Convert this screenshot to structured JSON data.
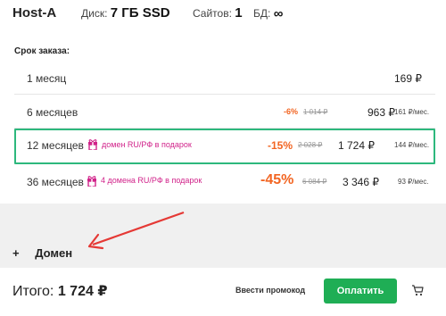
{
  "header": {
    "plan_name": "Host-A",
    "disk_label": "Диск:",
    "disk_value": "7 ГБ SSD",
    "sites_label": "Сайтов:",
    "sites_value": "1",
    "db_label": "БД:",
    "db_value": "∞"
  },
  "term_label": "Срок заказа:",
  "rows": [
    {
      "label": "1 месяц",
      "price": "169 ₽"
    },
    {
      "label": "6 месяцев",
      "discount": "-6%",
      "old_price": "1 014 ₽",
      "price": "963 ₽",
      "per_month": "161 ₽/мес."
    },
    {
      "label": "12 месяцев",
      "gift": "домен RU/РФ в подарок",
      "discount": "-15%",
      "old_price": "2 028 ₽",
      "price": "1 724 ₽",
      "per_month": "144 ₽/мес.",
      "selected": true
    },
    {
      "label": "36 месяцев",
      "gift": "4 домена RU/РФ в подарок",
      "discount": "-45%",
      "old_price": "6 084 ₽",
      "price": "3 346 ₽",
      "per_month": "93 ₽/мес."
    }
  ],
  "domain_section": {
    "plus": "+",
    "label": "Домен"
  },
  "footer": {
    "total_label": "Итого:",
    "total_amount": "1 724 ₽",
    "promo_link": "Ввести промокод",
    "pay_button": "Оплатить"
  },
  "colors": {
    "accent_green": "#1fae55",
    "selection_border": "#2db87d",
    "discount_orange": "#f26522",
    "gift_pink": "#d1238a",
    "arrow_red": "#e53935"
  }
}
